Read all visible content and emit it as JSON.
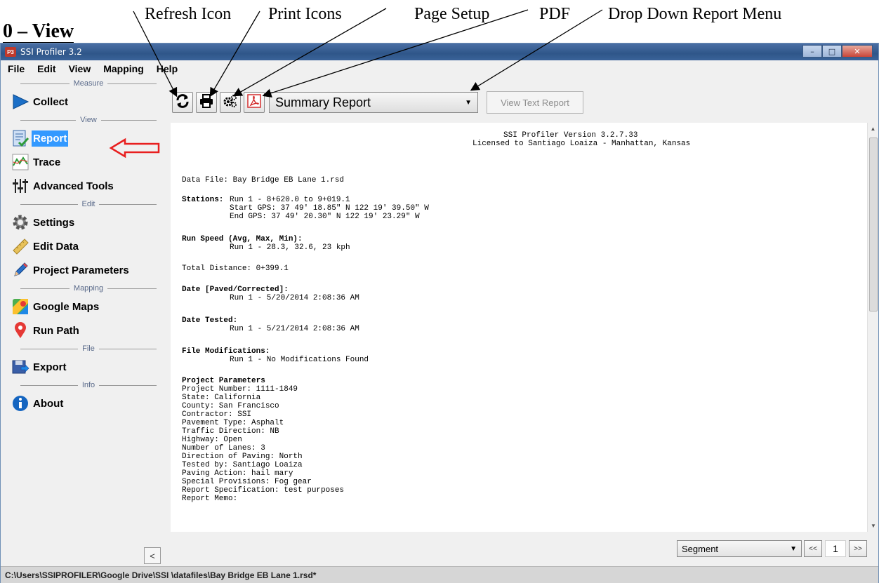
{
  "doc_heading": "0 – View",
  "annotations": {
    "refresh": "Refresh Icon",
    "print": "Print Icons",
    "page_setup": "Page Setup",
    "pdf": "PDF",
    "dropdown": "Drop Down Report Menu"
  },
  "window": {
    "title": "SSI Profiler 3.2",
    "icon_text": "P3"
  },
  "menu": [
    "File",
    "Edit",
    "View",
    "Mapping",
    "Help"
  ],
  "sidebar": {
    "sections": {
      "measure": "Measure",
      "view": "View",
      "edit": "Edit",
      "mapping": "Mapping",
      "file": "File",
      "info": "Info"
    },
    "items": {
      "collect": "Collect",
      "report": "Report",
      "trace": "Trace",
      "advanced_tools": "Advanced Tools",
      "settings": "Settings",
      "edit_data": "Edit Data",
      "project_parameters": "Project Parameters",
      "google_maps": "Google Maps",
      "run_path": "Run Path",
      "export": "Export",
      "about": "About"
    },
    "collapse_label": "<"
  },
  "toolbar": {
    "report_selected": "Summary Report",
    "view_text_report": "View Text Report"
  },
  "report": {
    "header1": "SSI Profiler Version 3.2.7.33",
    "header2": "Licensed to Santiago Loaiza - Manhattan, Kansas",
    "data_file": "Data File: Bay Bridge EB Lane 1.rsd",
    "stations_label": "Stations:",
    "stations_run": "Run 1 - 8+620.0 to 9+019.1",
    "start_gps": "Start GPS: 37 49' 18.85\" N 122 19' 39.50\" W",
    "end_gps": "End GPS: 37 49' 20.30\" N 122 19' 23.29\" W",
    "run_speed_label": "Run Speed (Avg, Max, Min):",
    "run_speed": "Run 1 - 28.3, 32.6, 23 kph",
    "total_distance": "Total Distance: 0+399.1",
    "date_paved_label": "Date [Paved/Corrected]:",
    "date_paved": "Run 1 - 5/20/2014 2:08:36 AM",
    "date_tested_label": "Date Tested:",
    "date_tested": "Run 1 - 5/21/2014 2:08:36 AM",
    "file_mod_label": "File Modifications:",
    "file_mod": "Run 1 - No Modifications Found",
    "project_params_title": "Project Parameters",
    "params": [
      "Project Number: 1111-1849",
      "State: California",
      "County: San Francisco",
      "Contractor: SSI",
      "Pavement Type: Asphalt",
      "Traffic Direction: NB",
      "Highway: Open",
      "Number of Lanes: 3",
      "Direction of Paving: North",
      "Tested by: Santiago Loaiza",
      "Paving Action: hail mary",
      "Special Provisions: Fog gear",
      "Report Specification: test purposes",
      "Report Memo:"
    ]
  },
  "bottom": {
    "segment_select": "Segment",
    "prev": "<<",
    "page": "1",
    "next": ">>"
  },
  "status_path": "C:\\Users\\SSIPROFILER\\Google Drive\\SSI  \\datafiles\\Bay Bridge EB Lane 1.rsd*"
}
